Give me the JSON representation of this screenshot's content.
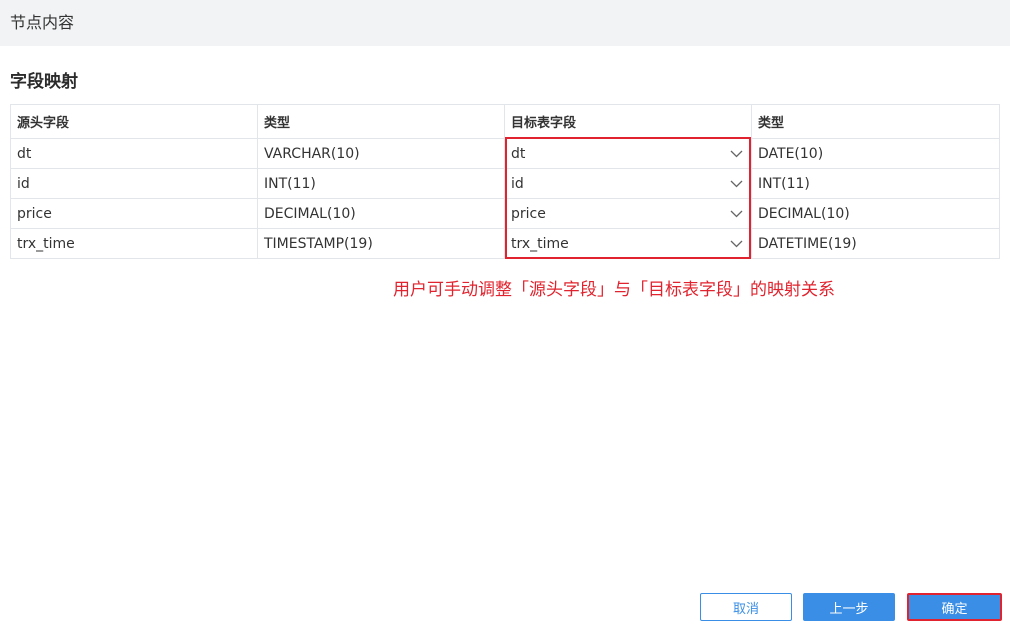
{
  "panel": {
    "title": "节点内容"
  },
  "section": {
    "title": "字段映射"
  },
  "table": {
    "headers": [
      "源头字段",
      "类型",
      "目标表字段",
      "类型"
    ],
    "rows": [
      {
        "source_field": "dt",
        "source_type": "VARCHAR(10)",
        "target_field": "dt",
        "target_type": "DATE(10)"
      },
      {
        "source_field": "id",
        "source_type": "INT(11)",
        "target_field": "id",
        "target_type": "INT(11)"
      },
      {
        "source_field": "price",
        "source_type": "DECIMAL(10)",
        "target_field": "price",
        "target_type": "DECIMAL(10)"
      },
      {
        "source_field": "trx_time",
        "source_type": "TIMESTAMP(19)",
        "target_field": "trx_time",
        "target_type": "DATETIME(19)"
      }
    ]
  },
  "annotation": "用户可手动调整「源头字段」与「目标表字段」的映射关系",
  "footer": {
    "cancel_label": "取消",
    "prev_label": "上一步",
    "confirm_label": "确定"
  },
  "colors": {
    "accent": "#3a8ee6",
    "highlight": "#e0232e",
    "header_bg": "#f2f3f5"
  },
  "icons": {
    "select_arrow": "chevron-down-icon"
  }
}
